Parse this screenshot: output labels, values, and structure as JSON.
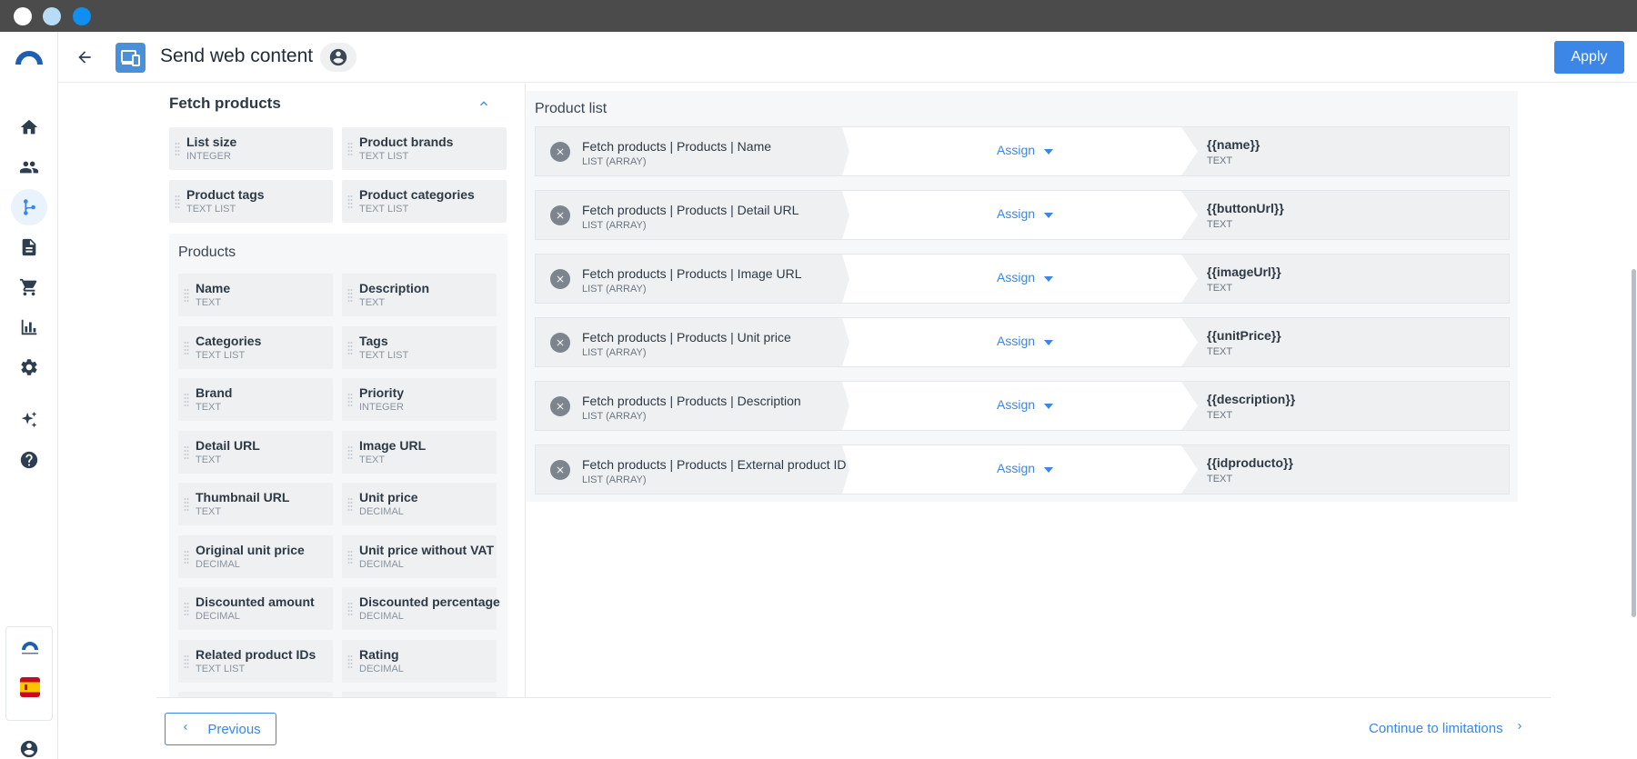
{
  "header": {
    "title": "Send web content",
    "apply_label": "Apply"
  },
  "colors": {
    "accent": "#3b86e6",
    "card_bg": "#eef0f2",
    "panel_bg": "#f6f7f8",
    "chrome": "#4b4b4b"
  },
  "nav": {
    "items": [
      "home-icon",
      "contacts-icon",
      "workflow-icon",
      "document-icon",
      "cart-icon",
      "chart-icon",
      "gear-icon",
      "sparkles-icon",
      "help-icon"
    ],
    "active": "workflow-icon"
  },
  "fetch_products": {
    "title": "Fetch products",
    "fields": [
      {
        "name": "List size",
        "type": "INTEGER"
      },
      {
        "name": "Product brands",
        "type": "TEXT LIST"
      },
      {
        "name": "Product tags",
        "type": "TEXT LIST"
      },
      {
        "name": "Product categories",
        "type": "TEXT LIST"
      }
    ]
  },
  "products": {
    "title": "Products",
    "fields": [
      {
        "name": "Name",
        "type": "TEXT"
      },
      {
        "name": "Description",
        "type": "TEXT"
      },
      {
        "name": "Categories",
        "type": "TEXT LIST"
      },
      {
        "name": "Tags",
        "type": "TEXT LIST"
      },
      {
        "name": "Brand",
        "type": "TEXT"
      },
      {
        "name": "Priority",
        "type": "INTEGER"
      },
      {
        "name": "Detail URL",
        "type": "TEXT"
      },
      {
        "name": "Image URL",
        "type": "TEXT"
      },
      {
        "name": "Thumbnail URL",
        "type": "TEXT"
      },
      {
        "name": "Unit price",
        "type": "DECIMAL"
      },
      {
        "name": "Original unit price",
        "type": "DECIMAL"
      },
      {
        "name": "Unit price without VAT",
        "type": "DECIMAL"
      },
      {
        "name": "Discounted amount",
        "type": "DECIMAL"
      },
      {
        "name": "Discounted percentage",
        "type": "DECIMAL"
      },
      {
        "name": "Related product IDs",
        "type": "TEXT LIST"
      },
      {
        "name": "Rating",
        "type": "DECIMAL"
      }
    ]
  },
  "product_list": {
    "title": "Product list",
    "assign_label": "Assign",
    "rows": [
      {
        "source": "Fetch products | Products | Name",
        "source_type": "LIST (ARRAY)",
        "target": "{{name}}",
        "target_type": "TEXT"
      },
      {
        "source": "Fetch products | Products | Detail URL",
        "source_type": "LIST (ARRAY)",
        "target": "{{buttonUrl}}",
        "target_type": "TEXT"
      },
      {
        "source": "Fetch products | Products | Image URL",
        "source_type": "LIST (ARRAY)",
        "target": "{{imageUrl}}",
        "target_type": "TEXT"
      },
      {
        "source": "Fetch products | Products | Unit price",
        "source_type": "LIST (ARRAY)",
        "target": "{{unitPrice}}",
        "target_type": "TEXT"
      },
      {
        "source": "Fetch products | Products | Description",
        "source_type": "LIST (ARRAY)",
        "target": "{{description}}",
        "target_type": "TEXT"
      },
      {
        "source": "Fetch products | Products | External product ID",
        "source_type": "LIST (ARRAY)",
        "target": "{{idproducto}}",
        "target_type": "TEXT"
      }
    ]
  },
  "footer": {
    "previous_label": "Previous",
    "continue_label": "Continue to limitations"
  }
}
